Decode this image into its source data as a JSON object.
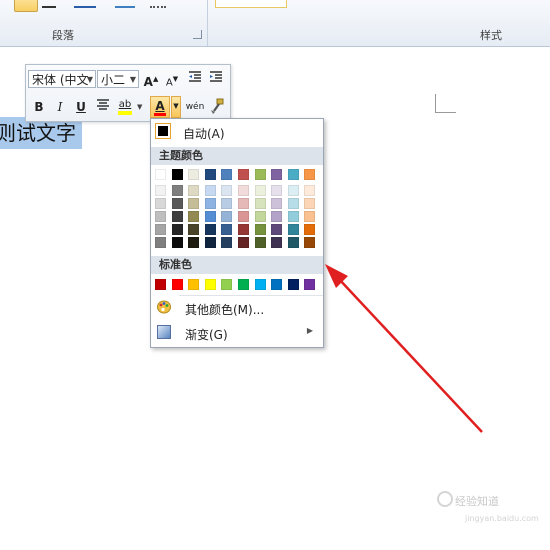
{
  "ribbon": {
    "paragraph_group_label": "段落",
    "styles_group_label": "样式"
  },
  "document": {
    "selected_text": "则试文字"
  },
  "mini_toolbar": {
    "font_name": "宋体 (中文",
    "font_size": "小二",
    "bold": "B",
    "italic": "I",
    "underline": "U",
    "highlight": "ab",
    "font_color": "A",
    "phonetic": "wén"
  },
  "color_menu": {
    "auto_label": "自动(A)",
    "theme_header": "主题颜色",
    "standard_header": "标准色",
    "more_colors_label": "其他颜色(M)...",
    "gradient_label": "渐变(G)",
    "theme_top_row": [
      "#ffffff",
      "#000000",
      "#eeece1",
      "#1f497d",
      "#4f81bd",
      "#c0504d",
      "#9bbb59",
      "#8064a2",
      "#4bacc6",
      "#f79646"
    ],
    "theme_shades": [
      [
        "#f2f2f2",
        "#d8d8d8",
        "#bfbfbf",
        "#a5a5a5",
        "#7f7f7f"
      ],
      [
        "#7f7f7f",
        "#595959",
        "#3f3f3f",
        "#262626",
        "#0c0c0c"
      ],
      [
        "#ddd9c3",
        "#c4bd97",
        "#938953",
        "#494429",
        "#1d1b10"
      ],
      [
        "#c6d9f0",
        "#8db3e2",
        "#548dd4",
        "#17365d",
        "#0f243e"
      ],
      [
        "#dbe5f1",
        "#b8cce4",
        "#95b3d7",
        "#366092",
        "#244061"
      ],
      [
        "#f2dcdb",
        "#e5b9b7",
        "#d99694",
        "#953734",
        "#632423"
      ],
      [
        "#ebf1dd",
        "#d7e3bc",
        "#c3d69b",
        "#76923c",
        "#4f6128"
      ],
      [
        "#e5e0ec",
        "#ccc1d9",
        "#b2a2c7",
        "#5f497a",
        "#3f3151"
      ],
      [
        "#dbeef3",
        "#b7dde8",
        "#92cddc",
        "#31859b",
        "#205867"
      ],
      [
        "#fdeada",
        "#fbd5b5",
        "#fac08f",
        "#e36c09",
        "#974806"
      ]
    ],
    "standard_colors": [
      "#c00000",
      "#ff0000",
      "#ffc000",
      "#ffff00",
      "#92d050",
      "#00b050",
      "#00b0f0",
      "#0070c0",
      "#002060",
      "#7030a0"
    ]
  },
  "watermark": {
    "text": "经验知道",
    "sub": "jingyan.baidu.com"
  },
  "colors": {
    "arrow": "#e02020",
    "selection": "#a9c9ec",
    "font_color_bar": "#ff0000"
  }
}
